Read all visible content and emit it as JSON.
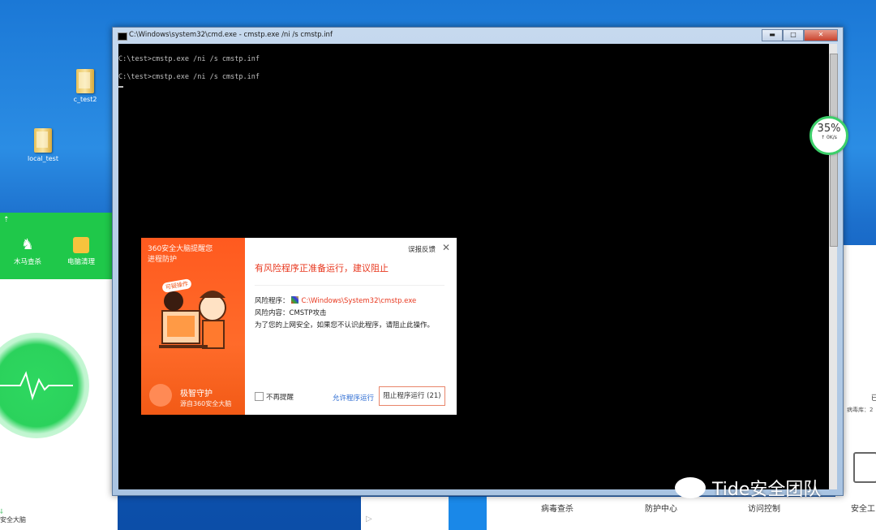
{
  "desktop": {
    "icons": [
      {
        "label": "c_test2",
        "icon": "folder-icon"
      },
      {
        "label": "local_test",
        "icon": "folder-icon"
      }
    ]
  },
  "cmd": {
    "title": "C:\\Windows\\system32\\cmd.exe - cmstp.exe  /ni /s cmstp.inf",
    "btn_min": "▬",
    "btn_max": "□",
    "btn_close": "✕",
    "lines": [
      "C:\\test>cmstp.exe /ni /s cmstp.inf",
      "C:\\test>cmstp.exe /ni /s cmstp.inf"
    ]
  },
  "speed": {
    "percent": "35%",
    "rate": "↑ 0K/s"
  },
  "alert": {
    "brand_line1": "360安全大脑提醒您",
    "brand_line2": "进程防护",
    "tag": "可疑操作",
    "protection_title": "极智守护",
    "protection_source": "源自360安全大脑",
    "feedback": "误报反馈",
    "close_glyph": "✕",
    "headline": "有风险程序正准备运行，建议阻止",
    "risk_program_label": "风险程序：",
    "risk_program_path": "C:\\Windows\\System32\\cmstp.exe",
    "risk_content_label": "风险内容：",
    "risk_content_value": "CMSTP攻击",
    "advice": "为了您的上网安全，如果您不认识此程序，请阻止此操作。",
    "dont_remind": "不再提醒",
    "allow": "允许程序运行",
    "block": "阻止程序运行 (21)"
  },
  "left_app": {
    "tools": [
      "木马查杀",
      "电脑清理"
    ],
    "footer": "安全大脑"
  },
  "right_app": {
    "partial_text": "已",
    "virus_db": "病毒库：2"
  },
  "bottom_nav": [
    "病毒查杀",
    "防护中心",
    "访问控制",
    "安全工"
  ],
  "watermark": {
    "text": "Tide安全团队"
  },
  "colors": {
    "alert_orange": "#ff5a1f",
    "alert_red_text": "#e8381f",
    "app_green": "#1fc84a",
    "link_blue": "#2a6ad2"
  }
}
